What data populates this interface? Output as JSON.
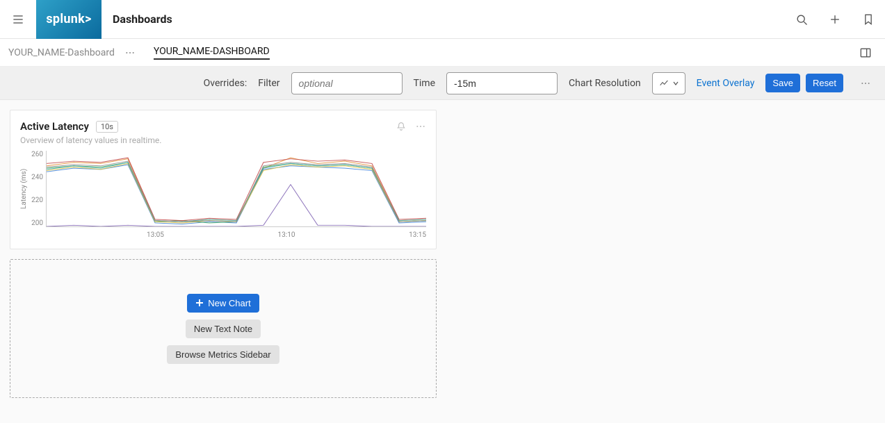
{
  "header": {
    "logo_text": "splunk>",
    "app_title": "Dashboards"
  },
  "breadcrumb": {
    "root": "YOUR_NAME-Dashboard",
    "current": "YOUR_NAME-DASHBOARD"
  },
  "overrides": {
    "label": "Overrides:",
    "filter_label": "Filter",
    "filter_placeholder": "optional",
    "time_label": "Time",
    "time_value": "-15m",
    "resolution_label": "Chart Resolution",
    "event_overlay_label": "Event Overlay",
    "save_label": "Save",
    "reset_label": "Reset"
  },
  "card": {
    "title": "Active Latency",
    "badge": "10s",
    "subtitle": "Overview of latency values in realtime.",
    "ylabel": "Latency (ms)"
  },
  "placeholder": {
    "new_chart": "New Chart",
    "new_note": "New Text Note",
    "browse_metrics": "Browse Metrics Sidebar"
  },
  "chart_data": {
    "type": "line",
    "xlabel": "",
    "ylabel": "Latency (ms)",
    "ylim": [
      200,
      265
    ],
    "x_ticks": [
      "13:05",
      "13:10",
      "13:15"
    ],
    "y_ticks": [
      200,
      220,
      240,
      260
    ],
    "x": [
      "13:01",
      "13:02",
      "13:03",
      "13:04",
      "13:05",
      "13:06",
      "13:07",
      "13:08",
      "13:09",
      "13:10",
      "13:11",
      "13:12",
      "13:13",
      "13:14",
      "13:15"
    ],
    "series": [
      {
        "name": "orange",
        "color": "#e38a2d",
        "values": [
          252,
          255,
          254,
          258,
          205,
          204,
          206,
          205,
          250,
          259,
          254,
          256,
          252,
          205,
          206
        ]
      },
      {
        "name": "blue",
        "color": "#3b7fd9",
        "values": [
          247,
          250,
          249,
          253,
          203,
          202,
          204,
          203,
          249,
          252,
          251,
          250,
          248,
          203,
          204
        ]
      },
      {
        "name": "green",
        "color": "#3fa85a",
        "values": [
          250,
          252,
          251,
          255,
          204,
          205,
          203,
          204,
          251,
          254,
          252,
          253,
          250,
          204,
          205
        ]
      },
      {
        "name": "red",
        "color": "#c04343",
        "values": [
          254,
          256,
          255,
          259,
          206,
          205,
          207,
          206,
          255,
          258,
          256,
          257,
          254,
          206,
          207
        ]
      },
      {
        "name": "yellow",
        "color": "#d8c03a",
        "values": [
          248,
          251,
          249,
          254,
          204,
          203,
          205,
          204,
          248,
          253,
          251,
          252,
          249,
          204,
          205
        ]
      },
      {
        "name": "purple",
        "color": "#7a5db0",
        "values": [
          200,
          201,
          200,
          201,
          200,
          200,
          200,
          200,
          201,
          236,
          201,
          201,
          200,
          200,
          200
        ]
      },
      {
        "name": "teal",
        "color": "#3aa6a6",
        "values": [
          249,
          252,
          250,
          255,
          205,
          204,
          206,
          205,
          250,
          254,
          252,
          253,
          250,
          205,
          206
        ]
      },
      {
        "name": "gray",
        "color": "#8a8a8a",
        "values": [
          251,
          253,
          252,
          256,
          205,
          204,
          205,
          204,
          252,
          255,
          253,
          254,
          251,
          204,
          205
        ]
      }
    ]
  }
}
